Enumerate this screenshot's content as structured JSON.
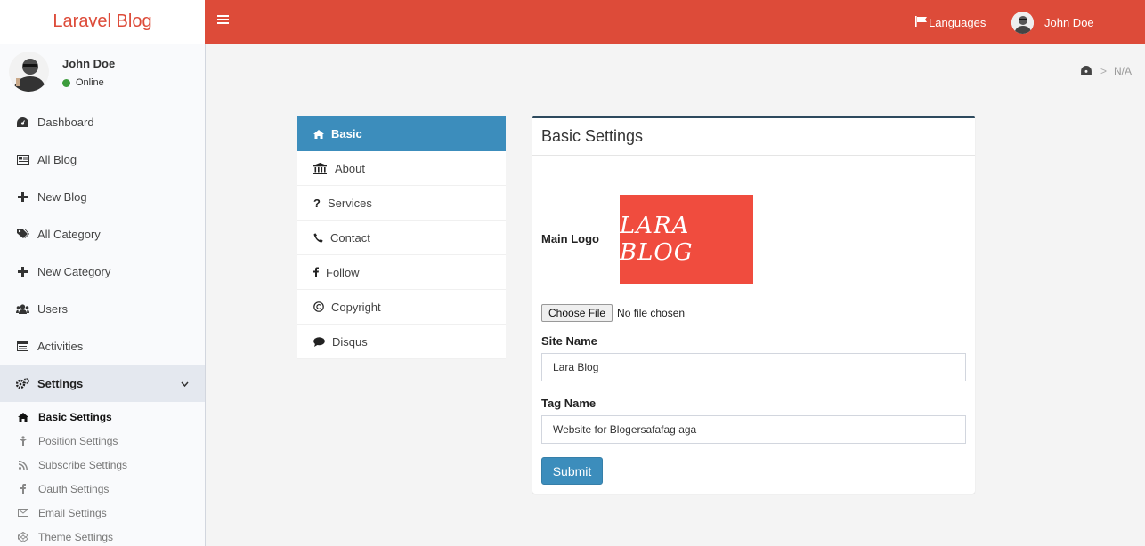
{
  "app": {
    "title": "Laravel Blog"
  },
  "colors": {
    "accent": "#dd4b39",
    "primary": "#3c8dbc",
    "logo_bg": "#f04c3e",
    "online": "#3c9c3c"
  },
  "navbar": {
    "toggle_icon": "hamburger-icon",
    "languages_label": "Languages",
    "languages_icon": "flag-icon",
    "user_name": "John Doe"
  },
  "sidebar": {
    "user": {
      "name": "John Doe",
      "status": "Online"
    },
    "items": [
      {
        "label": "Dashboard",
        "icon": "dashboard-icon"
      },
      {
        "label": "All Blog",
        "icon": "newspaper-icon"
      },
      {
        "label": "New Blog",
        "icon": "plus-icon"
      },
      {
        "label": "All Category",
        "icon": "tags-icon"
      },
      {
        "label": "New Category",
        "icon": "plus-icon"
      },
      {
        "label": "Users",
        "icon": "users-icon"
      },
      {
        "label": "Activities",
        "icon": "list-icon"
      },
      {
        "label": "Settings",
        "icon": "gears-icon"
      }
    ],
    "submenu": [
      {
        "label": "Basic Settings",
        "icon": "home-icon"
      },
      {
        "label": "Position Settings",
        "icon": "position-icon"
      },
      {
        "label": "Subscribe Settings",
        "icon": "rss-icon"
      },
      {
        "label": "Oauth Settings",
        "icon": "facebook-icon"
      },
      {
        "label": "Email Settings",
        "icon": "envelope-icon"
      },
      {
        "label": "Theme Settings",
        "icon": "codepen-icon"
      }
    ]
  },
  "breadcrumb": {
    "separator": ">",
    "current": "N/A"
  },
  "settings_nav": [
    {
      "label": "Basic",
      "icon": "home-icon"
    },
    {
      "label": "About",
      "icon": "bank-icon"
    },
    {
      "label": "Services",
      "icon": "question-icon"
    },
    {
      "label": "Contact",
      "icon": "phone-icon"
    },
    {
      "label": "Follow",
      "icon": "facebook-icon"
    },
    {
      "label": "Copyright",
      "icon": "copyright-icon"
    },
    {
      "label": "Disqus",
      "icon": "comment-icon"
    }
  ],
  "form": {
    "title": "Basic Settings",
    "logo_label": "Main Logo",
    "logo_text": "LARA BLOG",
    "file_button": "Choose File",
    "file_status": "No file chosen",
    "site_name_label": "Site Name",
    "site_name_value": "Lara Blog",
    "tag_name_label": "Tag Name",
    "tag_name_value": "Website for Blogersafafag aga",
    "submit_label": "Submit"
  }
}
